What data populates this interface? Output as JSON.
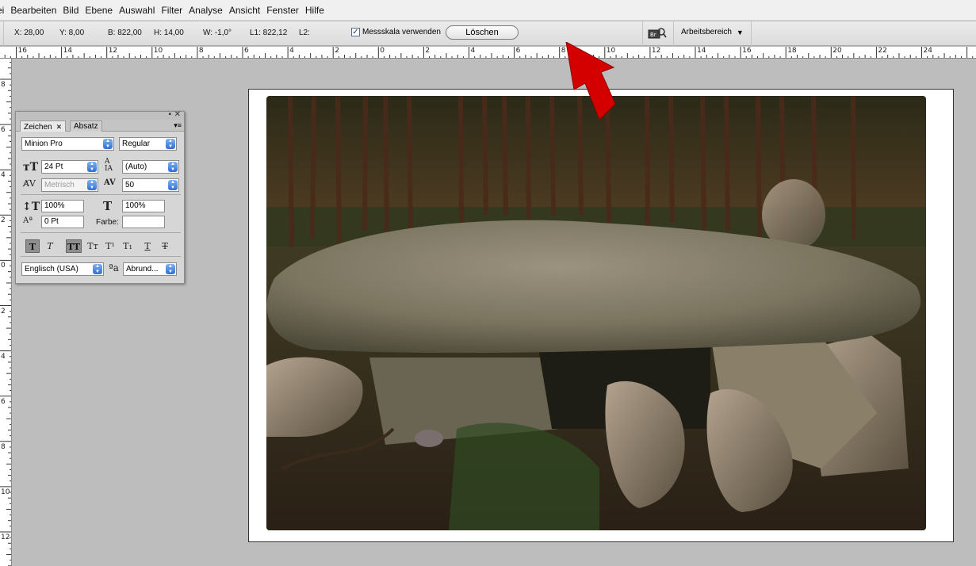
{
  "menu": [
    "ei",
    "Bearbeiten",
    "Bild",
    "Ebene",
    "Auswahl",
    "Filter",
    "Analyse",
    "Ansicht",
    "Fenster",
    "Hilfe"
  ],
  "options": {
    "x": "X: 28,00",
    "y": "Y: 8,00",
    "b": "B: 822,00",
    "h": "H: 14,00",
    "w": "W: -1,0°",
    "l1": "L1: 822,12",
    "l2": "L2:",
    "measure_label": "Messskala verwenden",
    "clear_label": "Löschen",
    "workspace_label": "Arbeitsbereich"
  },
  "ruler_top": [
    "16",
    "14",
    "12",
    "10",
    "8",
    "6",
    "4",
    "2",
    "0",
    "2",
    "4",
    "6",
    "8",
    "10",
    "12",
    "14",
    "16",
    "18",
    "20",
    "22",
    "24"
  ],
  "ruler_left": [
    "8",
    "6",
    "4",
    "2",
    "0",
    "2",
    "4",
    "6",
    "8",
    "10",
    "12"
  ],
  "panel": {
    "tab_active": "Zeichen",
    "tab_inactive": "Absatz",
    "font_family": "Minion Pro",
    "font_style": "Regular",
    "font_size": "24 Pt",
    "leading": "(Auto)",
    "kerning": "Metrisch",
    "tracking": "50",
    "vertical_scale": "100%",
    "horizontal_scale": "100%",
    "baseline_shift": "0 Pt",
    "color_label": "Farbe:",
    "language": "Englisch (USA)",
    "antialias": "Abrund..."
  },
  "colors": {
    "arrow": "#d40000",
    "menubar": "#f0f0f0",
    "canvas_bg": "#bdbdbd"
  }
}
